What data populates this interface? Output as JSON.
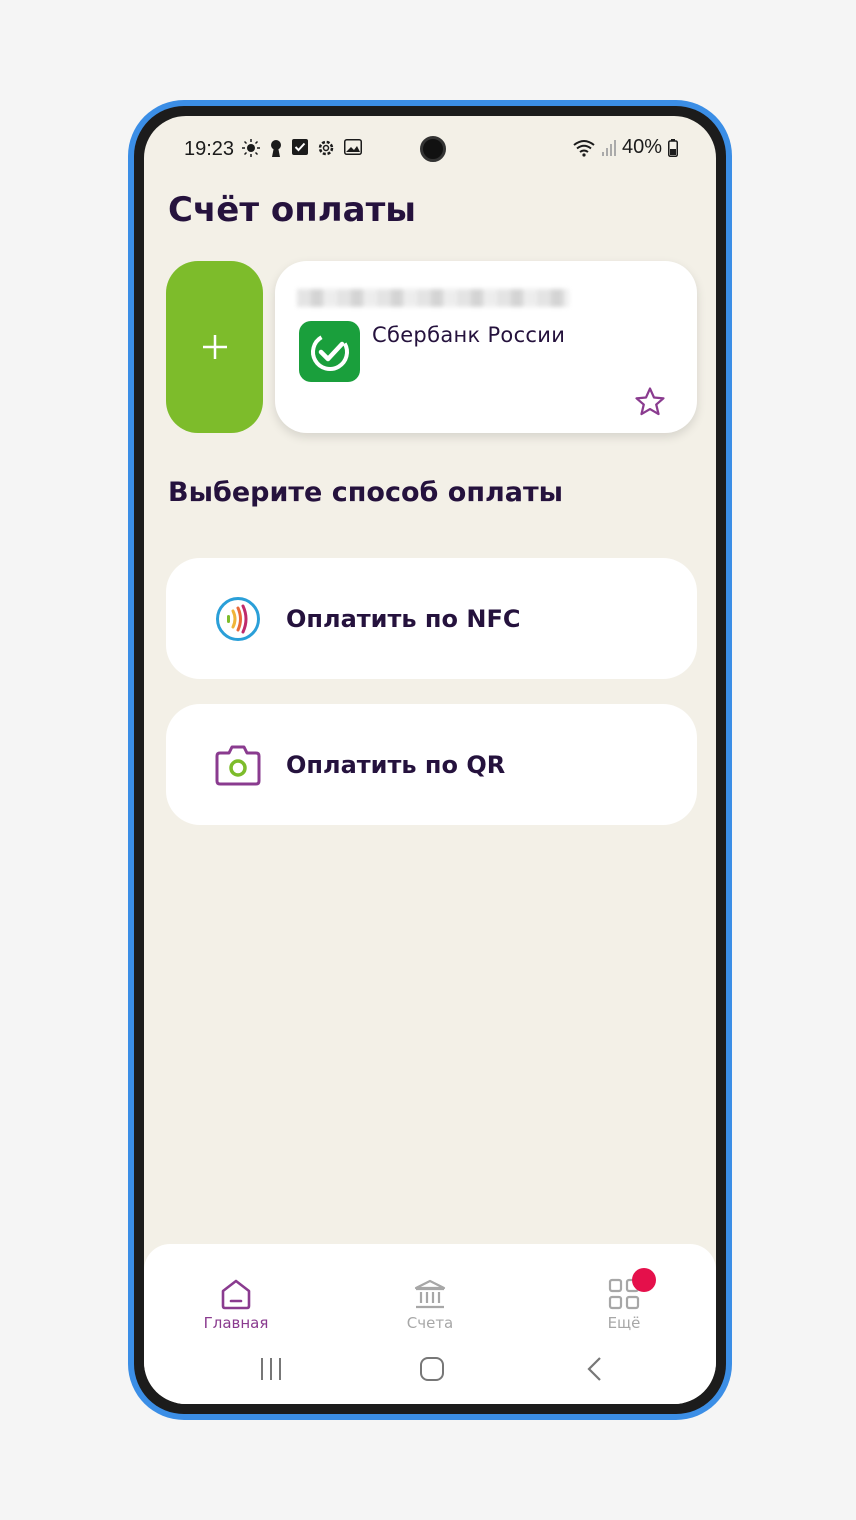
{
  "status_bar": {
    "time": "19:23",
    "battery": "40%"
  },
  "page_title": "Счёт оплаты",
  "card": {
    "bank_name": "Сбербанк России"
  },
  "section_title": "Выберите способ оплаты",
  "pay_options": [
    {
      "label": "Оплатить по NFC",
      "icon": "nfc-icon"
    },
    {
      "label": "Оплатить по QR",
      "icon": "camera-icon"
    }
  ],
  "bottom_nav": {
    "items": [
      {
        "label": "Главная",
        "icon": "home-icon",
        "active": true
      },
      {
        "label": "Счета",
        "icon": "bank-building-icon",
        "active": false
      },
      {
        "label": "Ещё",
        "icon": "grid-icon",
        "active": false
      }
    ]
  },
  "colors": {
    "accent_green": "#7dbc2b",
    "accent_purple": "#8a3b8f",
    "title_dark": "#25123d",
    "badge_red": "#e5104b",
    "background": "#f3f0e7"
  }
}
